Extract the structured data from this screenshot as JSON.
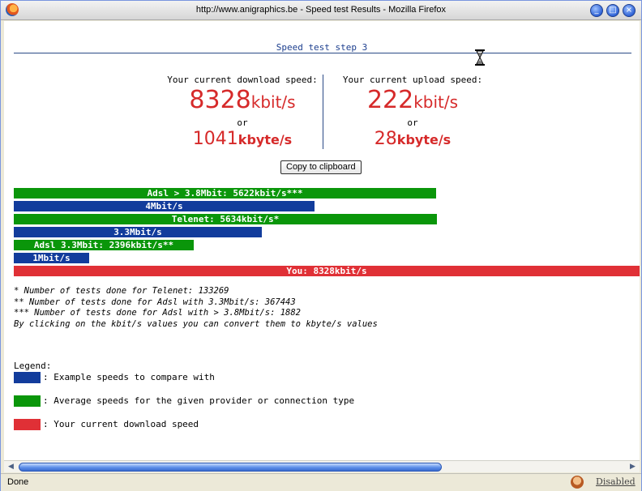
{
  "window": {
    "title": "http://www.anigraphics.be - Speed test Results - Mozilla Firefox",
    "buttons": {
      "minimize": "_",
      "maximize": "□",
      "close": "×"
    }
  },
  "page": {
    "step_title": "Speed test step 3",
    "download": {
      "label": "Your current download speed:",
      "kbit_value": "8328",
      "kbit_unit": "kbit/s",
      "or": "or",
      "kbyte_value": "1041",
      "kbyte_unit": "kbyte/s"
    },
    "upload": {
      "label": "Your current upload speed:",
      "kbit_value": "222",
      "kbit_unit": "kbit/s",
      "or": "or",
      "kbyte_value": "28",
      "kbyte_unit": "kbyte/s"
    },
    "copy_button": "Copy to clipboard",
    "bars": [
      {
        "label": "Adsl > 3.8Mbit: 5622kbit/s***",
        "value_kbit": 5622,
        "color": "#0a960a"
      },
      {
        "label": "4Mbit/s",
        "value_kbit": 4000,
        "color": "#123c9c"
      },
      {
        "label": "Telenet: 5634kbit/s*",
        "value_kbit": 5634,
        "color": "#0a960a"
      },
      {
        "label": "3.3Mbit/s",
        "value_kbit": 3300,
        "color": "#123c9c"
      },
      {
        "label": "Adsl 3.3Mbit: 2396kbit/s**",
        "value_kbit": 2396,
        "color": "#0a960a"
      },
      {
        "label": "1Mbit/s",
        "value_kbit": 1000,
        "color": "#123c9c"
      },
      {
        "label": "You: 8328kbit/s",
        "value_kbit": 8328,
        "color": "#e03036"
      }
    ],
    "notes": [
      "* Number of tests done for Telenet: 133269",
      "** Number of tests done for Adsl with 3.3Mbit/s: 367443",
      "*** Number of tests done for Adsl with > 3.8Mbit/s: 1882",
      "By clicking on the kbit/s values you can convert them to kbyte/s values"
    ],
    "legend": {
      "title": "Legend:",
      "items": [
        {
          "text": ": Example speeds to compare with",
          "color": "#123c9c"
        },
        {
          "text": ": Average speeds for the given provider or connection type",
          "color": "#0a960a"
        },
        {
          "text": ": Your current download speed",
          "color": "#e03036"
        }
      ]
    }
  },
  "statusbar": {
    "text": "Done",
    "disabled_label": "Disabled"
  }
}
